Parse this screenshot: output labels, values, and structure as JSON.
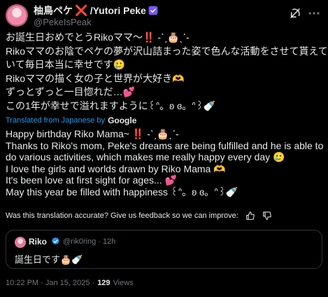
{
  "post": {
    "author": {
      "display_name": "柚鳥ペケ",
      "display_name_suffix": "/Yutori Peke",
      "name_mark": "❌",
      "handle": "@PekeIsPeak"
    },
    "original_lines": [
      "お誕生日おめでとうRikoママ〜‼️ -ˋˏ🎂ˎˊ-",
      "Rikoママのお陰でペケの夢が沢山詰まった姿で色んな活動をさせて貰えて",
      "いて毎日本当に幸せです🥲",
      "Rikoママの描く女の子と世界が大好き🫶",
      "ずっとずっと一目惚れだ…💕",
      "この1年が幸せで溢れますように꒰ᐢ。ʚ ɞ。ᐢ꒱🍼"
    ],
    "translated_from": "Translated from Japanese by",
    "translator": "Google",
    "translation_lines": [
      "Happy birthday Riko Mama~ ‼️ -ˋˏ🎂ˎˊ-",
      "Thanks to Riko's mom, Peke's dreams are being fulfilled and he is able to",
      "do various activities, which makes me really happy every day 🥲",
      "I love the girls and worlds drawn by Riko Mama 🫶",
      "It's been love at first sight for ages... 💕",
      "May this year be filled with happiness ꒰ᐢ。ʚ ɞ。ᐢ꒱🍼"
    ],
    "feedback_prompt": "Was this translation accurate? Give us feedback so we can improve:",
    "quote": {
      "name": "Riko",
      "handle": "@rik0ring",
      "time": "· 12h",
      "text": "誕生日です🎂🍼"
    },
    "timestamp": "10:22 PM · Jan 15, 2025 ·",
    "views_count": "129",
    "views_label": "Views"
  },
  "icons": {
    "verified": "verified-badge-icon",
    "grok": "grok-icon",
    "more": "more-icon",
    "thumbs_up": "thumbs-up-icon",
    "thumbs_down": "thumbs-down-icon"
  },
  "colors": {
    "background": "#000000",
    "text": "#e7e9ea",
    "secondary": "#71767b",
    "link": "#1d9bf0",
    "verified": "#1d9bf0",
    "border": "#2f3336"
  }
}
